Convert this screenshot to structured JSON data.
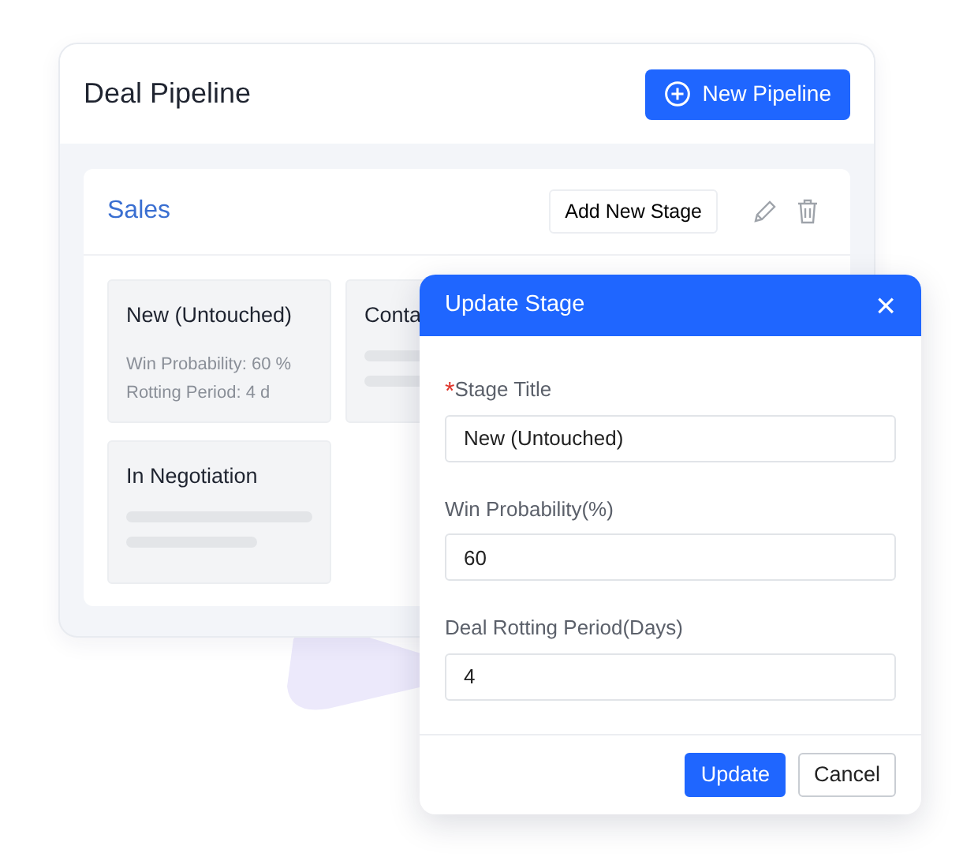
{
  "page": {
    "title": "Deal Pipeline",
    "new_button": "New Pipeline"
  },
  "pipeline": {
    "name": "Sales",
    "add_button": "Add New Stage"
  },
  "stages": [
    {
      "kind": "details",
      "title": "New (Untouched)",
      "lines": [
        "Win Probability: 60 %",
        "Rotting Period: 4 d"
      ]
    },
    {
      "kind": "skeleton",
      "title": "Conta"
    },
    {
      "kind": "skeleton",
      "title": "In Negotiation"
    }
  ],
  "dialog": {
    "title": "Update Stage",
    "close": "×",
    "fields": [
      {
        "required_mark": "*",
        "label": "Stage Title",
        "value": "New (Untouched)"
      },
      {
        "label": "Win Probability(%)",
        "value": "60"
      },
      {
        "label": "Deal Rotting Period(Days)",
        "value": "4"
      }
    ],
    "buttons": [
      {
        "kind": "primary",
        "label": "Update"
      },
      {
        "kind": "secondary",
        "label": "Cancel"
      }
    ]
  }
}
